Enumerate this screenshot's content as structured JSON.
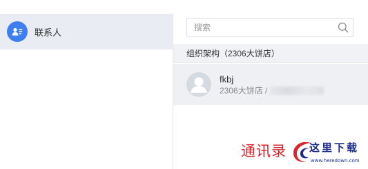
{
  "sidebar": {
    "items": [
      {
        "label": "联系人",
        "icon": "contact-card-icon",
        "active": true
      }
    ]
  },
  "search": {
    "placeholder": "搜索",
    "value": ""
  },
  "directory": {
    "section_title": "组织架构（2306大饼店）",
    "contacts": [
      {
        "name": "fkbj",
        "org": "2306大饼店 /"
      }
    ]
  },
  "watermark": {
    "caption": "通讯录",
    "logo_title": "这里下载",
    "logo_url": "www.heredown.com"
  },
  "colors": {
    "accent": "#3f7ef1",
    "watermark_red": "#d7262d",
    "watermark_blue": "#1d2d8a"
  }
}
